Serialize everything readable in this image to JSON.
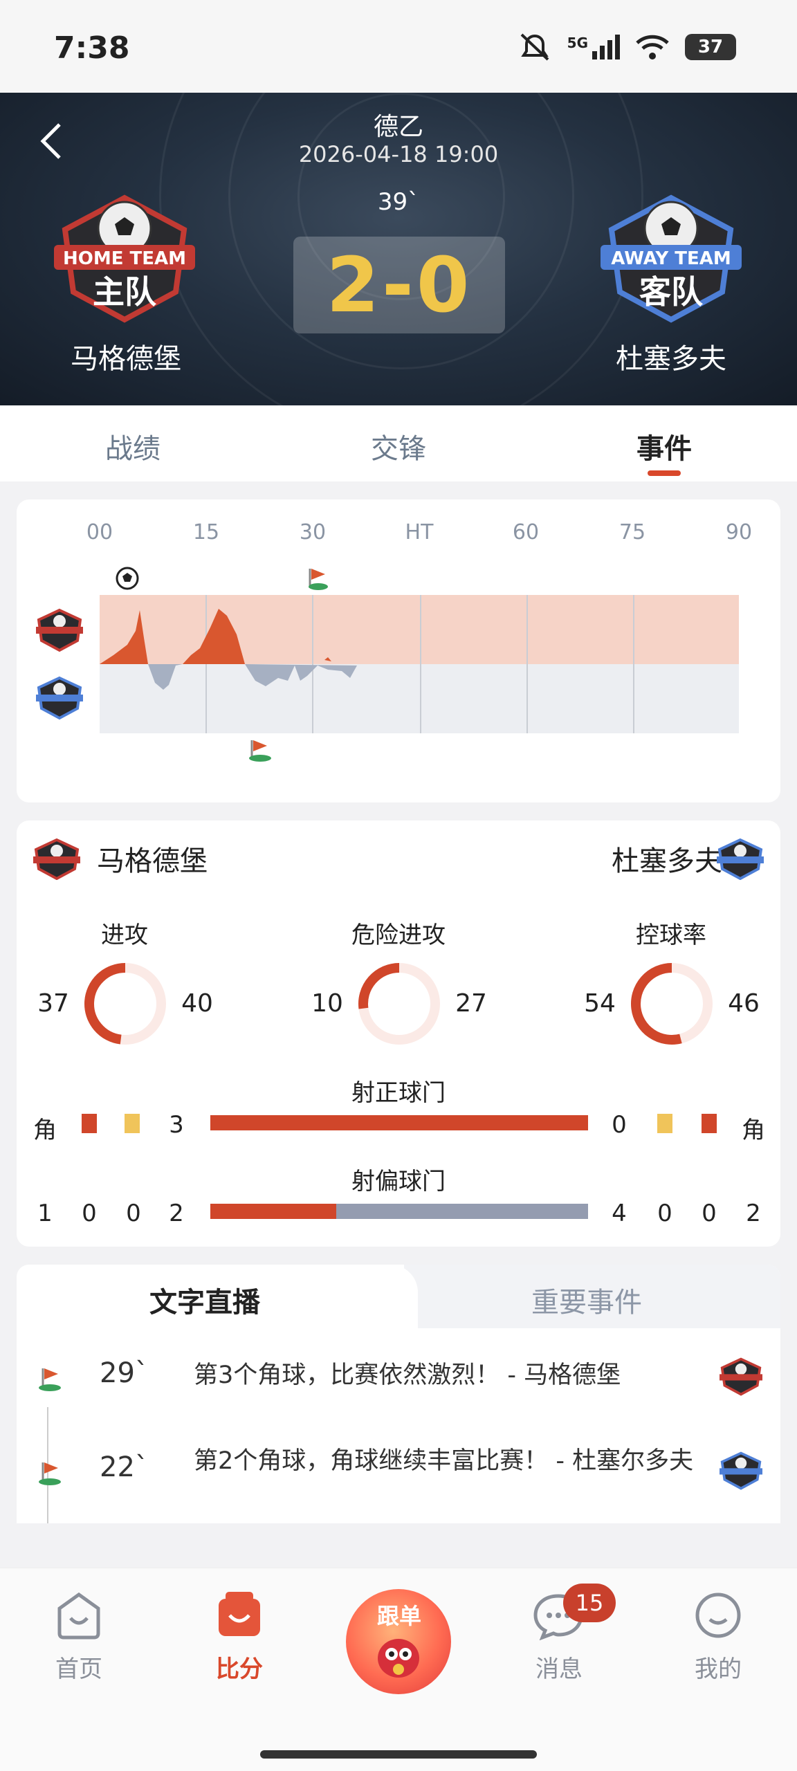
{
  "status_bar": {
    "time": "7:38",
    "network": "5G",
    "battery": "37"
  },
  "match": {
    "league": "德乙",
    "datetime": "2026-04-18 19:00",
    "minute": "39`",
    "score": "2-0",
    "home": {
      "name": "马格德堡",
      "badge_top": "HOME TEAM",
      "badge_main": "主队"
    },
    "away": {
      "name": "杜塞多夫",
      "badge_top": "AWAY TEAM",
      "badge_main": "客队"
    }
  },
  "tabs": [
    {
      "label": "战绩",
      "active": false
    },
    {
      "label": "交锋",
      "active": false
    },
    {
      "label": "事件",
      "active": true
    }
  ],
  "timeline": {
    "ticks": [
      "00",
      "15",
      "30",
      "HT",
      "60",
      "75",
      "90"
    ],
    "colors": {
      "home": "#d9572f",
      "home_bg": "#f6d3c7",
      "away": "#a6b0c2",
      "away_bg": "#eceef2"
    }
  },
  "stats": {
    "home_name": "马格德堡",
    "away_name": "杜塞多夫",
    "rings": [
      {
        "title": "进攻",
        "home": "37",
        "away": "40",
        "home_value": 37,
        "away_value": 40
      },
      {
        "title": "危险进攻",
        "home": "10",
        "away": "27",
        "home_value": 10,
        "away_value": 27
      },
      {
        "title": "控球率",
        "home": "54",
        "away": "46",
        "home_value": 54,
        "away_value": 46
      }
    ],
    "corner_label": "角",
    "shots_on": {
      "title": "射正球门",
      "home": "3",
      "away": "0",
      "home_value": 3,
      "away_value": 0
    },
    "shots_off": {
      "title": "射偏球门",
      "home": "2",
      "away": "4",
      "home_value": 2,
      "away_value": 4
    },
    "home_counts": [
      "1",
      "0",
      "0"
    ],
    "away_counts": [
      "0",
      "0",
      "2"
    ],
    "colors": {
      "home": "#d0462a",
      "away": "#949cb0",
      "yellow": "#f0c45a",
      "ring_bg": "#fbeae6"
    }
  },
  "live": {
    "tabs": [
      "文字直播",
      "重要事件"
    ],
    "events": [
      {
        "minute": "29`",
        "text": "第3个角球，比赛依然激烈！ - 马格德堡",
        "team": "home"
      },
      {
        "minute": "22`",
        "text": "第2个角球，角球继续丰富比赛！ - 杜塞尔多夫",
        "team": "away"
      }
    ]
  },
  "nav": {
    "items": [
      "首页",
      "比分",
      "跟单",
      "消息",
      "我的"
    ],
    "badge": "15",
    "active": "比分"
  }
}
